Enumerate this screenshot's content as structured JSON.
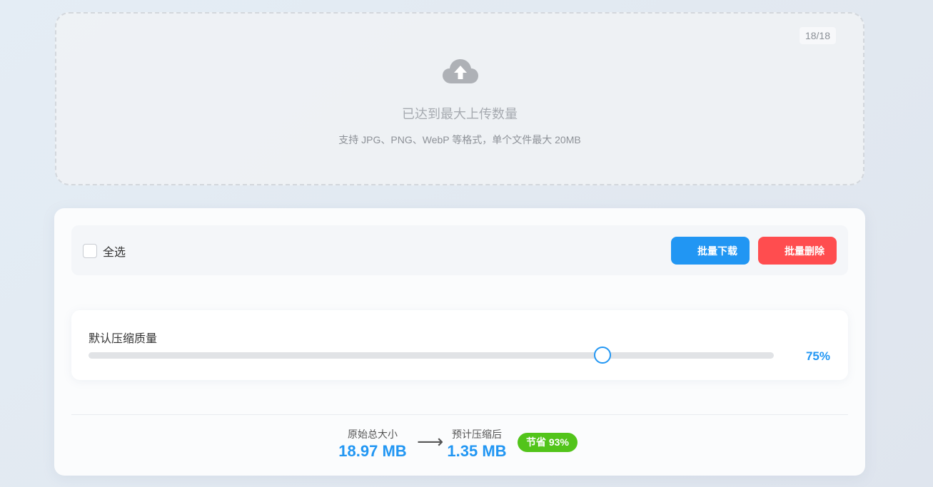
{
  "upload": {
    "counter": "18/18",
    "title": "已达到最大上传数量",
    "hint": "支持 JPG、PNG、WebP 等格式，单个文件最大 20MB",
    "icon": "cloud-upload-icon"
  },
  "toolbar": {
    "select_all_label": "全选",
    "select_all_checked": false,
    "download_label": "批量下载",
    "delete_label": "批量删除"
  },
  "quality": {
    "label": "默认压缩质量",
    "value_text": "75%",
    "value_percent": 75
  },
  "stats": {
    "original_label": "原始总大小",
    "original_value": "18.97 MB",
    "arrow": "⟶",
    "compressed_label": "预计压缩后",
    "compressed_value": "1.35 MB",
    "saving_badge": "节省 93%"
  },
  "colors": {
    "accent": "#2196f3",
    "danger": "#ff4d4f",
    "success": "#52c41a"
  }
}
